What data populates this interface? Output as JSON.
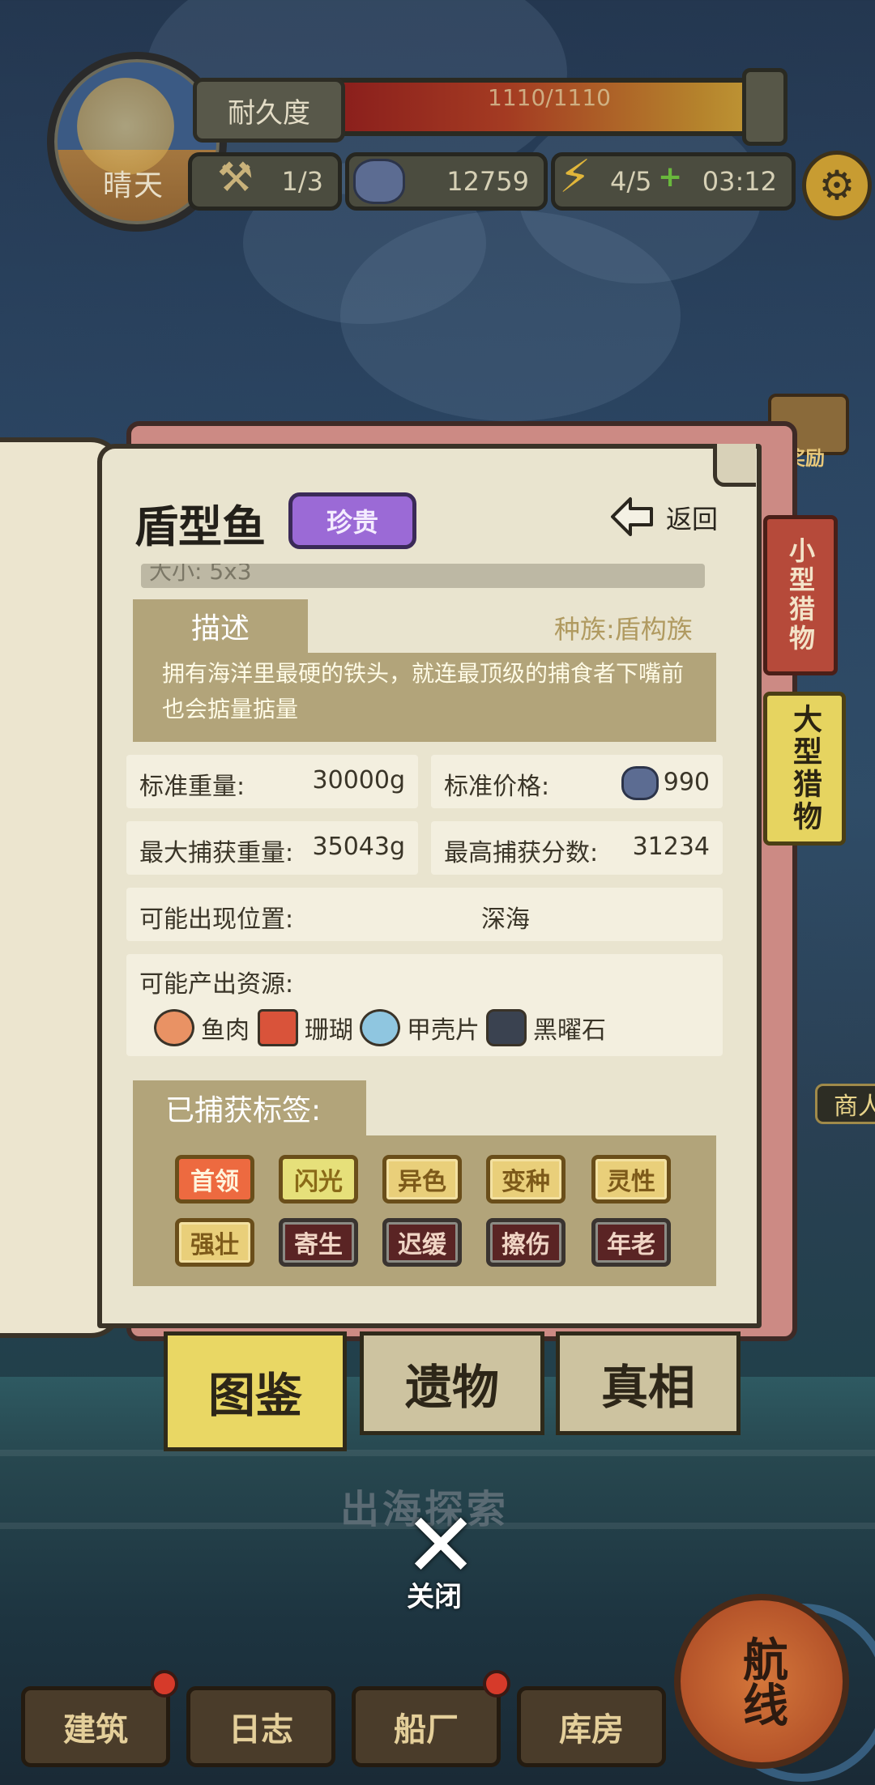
{
  "hud": {
    "weather": "晴天",
    "durability_label": "耐久度",
    "durability_value": "1110/1110",
    "durability_fraction": 1.0,
    "tools_count": "1/3",
    "currency": "12759",
    "energy": "4/5",
    "energy_timer": "03:12"
  },
  "side_tabs": {
    "reward": "奖励",
    "small_prey": "小型猎物",
    "large_prey": "大型猎物",
    "merchant": "商人"
  },
  "entry": {
    "name": "盾型鱼",
    "rarity": "珍贵",
    "back_label": "返回",
    "size_text": "大小: 5x3",
    "desc_tab": "描述",
    "species": "种族:盾构族",
    "description": "拥有海洋里最硬的铁头，就连最顶级的捕食者下嘴前也会掂量掂量",
    "stats": {
      "std_weight_label": "标准重量:",
      "std_weight": "30000g",
      "std_price_label": "标准价格:",
      "std_price": "990",
      "max_weight_label": "最大捕获重量:",
      "max_weight": "35043g",
      "max_score_label": "最高捕获分数:",
      "max_score": "31234",
      "location_label": "可能出现位置:",
      "location": "深海"
    },
    "resources_label": "可能产出资源:",
    "resources": [
      "鱼肉",
      "珊瑚",
      "甲壳片",
      "黑曜石"
    ],
    "caught_tags_label": "已捕获标签:",
    "tags": [
      "首领",
      "闪光",
      "异色",
      "变种",
      "灵性",
      "强壮",
      "寄生",
      "迟缓",
      "擦伤",
      "年老"
    ]
  },
  "book_tabs": [
    "图鉴",
    "遗物",
    "真相"
  ],
  "bottom": {
    "explore": "出海探索",
    "close": "关闭",
    "nav": [
      "建筑",
      "日志",
      "船厂",
      "库房"
    ],
    "route": "航线"
  },
  "colors": {
    "rarity_purple": "#9b6ad6",
    "panel_tan": "#b2a47a",
    "active_tab_yellow": "#e9d764"
  }
}
